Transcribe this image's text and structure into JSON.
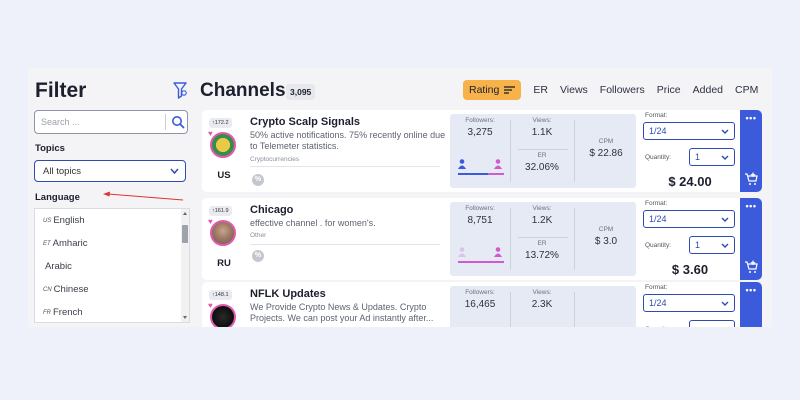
{
  "filter": {
    "title": "Filter",
    "search_placeholder": "Search ...",
    "topics_label": "Topics",
    "topics_value": "All topics",
    "language_label": "Language",
    "languages": [
      {
        "code": "US",
        "name": "English"
      },
      {
        "code": "ET",
        "name": "Amharic"
      },
      {
        "code": "",
        "name": "Arabic"
      },
      {
        "code": "CN",
        "name": "Chinese"
      },
      {
        "code": "FR",
        "name": "French"
      }
    ]
  },
  "header": {
    "title": "Channels",
    "count": "3,095",
    "sort_options": [
      "Rating",
      "ER",
      "Views",
      "Followers",
      "Price",
      "Added",
      "CPM"
    ],
    "active_sort": "Rating"
  },
  "labels": {
    "followers": "Followers:",
    "views": "Views:",
    "er": "ER",
    "cpm": "CPM",
    "format": "Format:",
    "quantity": "Quantity:",
    "more": "•••"
  },
  "channels": [
    {
      "rating": "172.2",
      "country": "US",
      "name": "Crypto Scalp Signals",
      "description": "50% active notifications. 75% recently online due to Telemeter statistics.",
      "category": "Cryptocurrencies",
      "followers": "3,275",
      "views": "1.1K",
      "er": "32.06%",
      "cpm": "$ 22.86",
      "format": "1/24",
      "quantity": "1",
      "price": "$ 24.00"
    },
    {
      "rating": "161.9",
      "country": "RU",
      "name": "Chicago",
      "description": "effective channel . for women's.",
      "category": "Other",
      "followers": "8,751",
      "views": "1.2K",
      "er": "13.72%",
      "cpm": "$ 3.0",
      "format": "1/24",
      "quantity": "1",
      "price": "$ 3.60"
    },
    {
      "rating": "148.1",
      "country": "",
      "name": "NFLK Updates",
      "description": "We Provide Crypto News & Updates. Crypto Projects. We can post your Ad instantly after...",
      "category": "",
      "followers": "16,465",
      "views": "2.3K",
      "er": "",
      "cpm": "",
      "format": "1/24",
      "quantity": "",
      "price": ""
    }
  ],
  "colors": {
    "accent_blue": "#3b5bdb",
    "sort_active": "#f7b24a",
    "annotation_arrow": "#e0322f",
    "stats_bg": "#e6eaf4"
  }
}
